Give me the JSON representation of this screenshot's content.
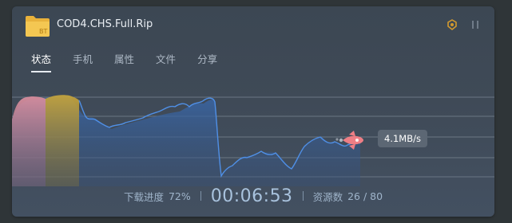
{
  "task": {
    "name": "COD4.CHS.Full.Rip",
    "file_badge": "BT"
  },
  "tabs": [
    {
      "label": "状态",
      "active": true
    },
    {
      "label": "手机",
      "active": false
    },
    {
      "label": "属性",
      "active": false
    },
    {
      "label": "文件",
      "active": false
    },
    {
      "label": "分享",
      "active": false
    }
  ],
  "chart": {
    "speed_label": "4.1MB/s",
    "colors": {
      "line": "#4f8fe6",
      "fill": "#37609b",
      "seg_pink": "#d68b9c",
      "seg_gold": "#b79a3a",
      "rocket": "#ee7e85"
    }
  },
  "footer": {
    "progress_label": "下载进度",
    "progress_value": "72%",
    "elapsed": "00:06:53",
    "resources_label": "资源数",
    "resources_value": "26 / 80"
  },
  "icons": {
    "header_left": "bt-folder-icon",
    "header_right_1": "hat-icon",
    "header_right_2": "pause-icon"
  }
}
